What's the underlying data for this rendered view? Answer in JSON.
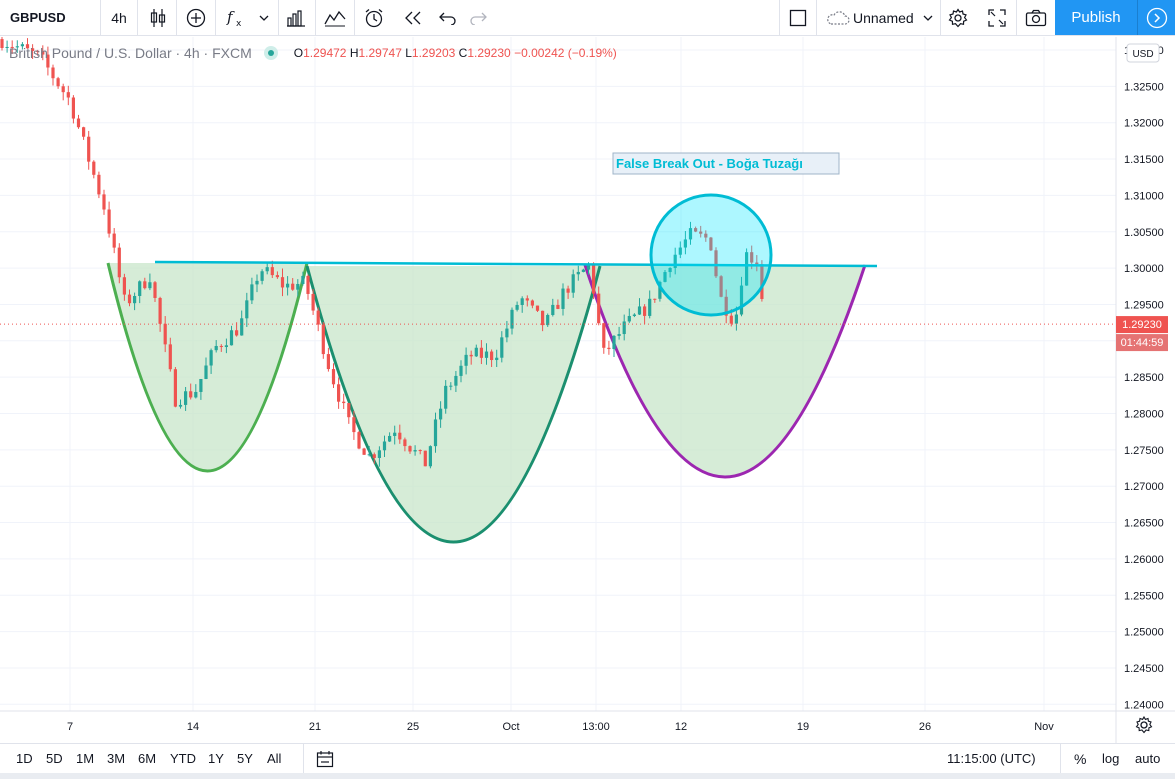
{
  "toolbar": {
    "symbol": "GBPUSD",
    "interval": "4h",
    "layout_name": "Unnamed",
    "publish_label": "Publish"
  },
  "legend": {
    "title": "British Pound / U.S. Dollar · 4h · FXCM",
    "open_label": "O",
    "open": "1.29472",
    "high_label": "H",
    "high": "1.29747",
    "low_label": "L",
    "low": "1.29203",
    "close_label": "C",
    "close": "1.29230",
    "change": "−0.00242 (−0.19%)"
  },
  "price_axis": {
    "currency_badge": "USD",
    "current_price": "1.29230",
    "countdown": "01:44:59"
  },
  "annotation": {
    "text": "False Break Out - Boğa Tuzağı"
  },
  "bottom": {
    "ranges": [
      "1D",
      "5D",
      "1M",
      "3M",
      "6M",
      "YTD",
      "1Y",
      "5Y",
      "All"
    ],
    "clock": "11:15:00 (UTC)",
    "percent_label": "%",
    "log_label": "log",
    "auto_label": "auto"
  },
  "colors": {
    "up": "#26a69a",
    "down": "#ef5350",
    "accent": "#2196f3",
    "neckline": "#00bcd4",
    "left_cup": "#4caf50",
    "mid_cup": "#1b8f6f",
    "right_cup": "#9c27b0",
    "fill": "#c8e6c9"
  },
  "chart_data": {
    "type": "candlestick",
    "title": "British Pound / U.S. Dollar · 4h · FXCM",
    "x_tick_labels": [
      "7",
      "14",
      "21",
      "25",
      "Oct",
      "13:00",
      "12",
      "19",
      "26",
      "Nov"
    ],
    "y_tick_labels": [
      "1.33000",
      "1.32500",
      "1.32000",
      "1.31500",
      "1.31000",
      "1.30500",
      "1.30000",
      "1.29500",
      "1.29000",
      "1.28500",
      "1.28000",
      "1.27500",
      "1.27000",
      "1.26500",
      "1.26000",
      "1.25500",
      "1.25000",
      "1.24500",
      "1.24000"
    ],
    "ylim": [
      1.2375,
      1.3325
    ],
    "last_close": 1.2923,
    "neckline_level": 1.3005,
    "grid": true
  }
}
